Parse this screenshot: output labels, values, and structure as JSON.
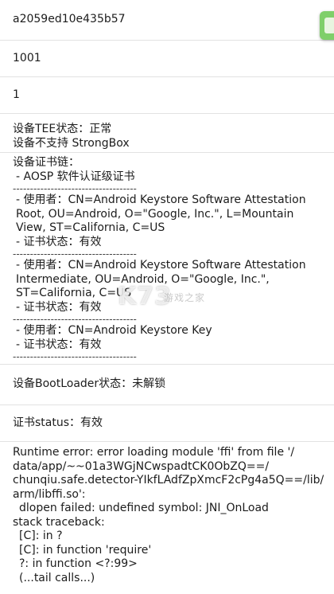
{
  "rows": {
    "device_id": "a2059ed10e435b57",
    "value_1001": "1001",
    "value_1": "1",
    "tee": {
      "status": "设备TEE状态：正常",
      "strongbox": "设备不支持 StrongBox"
    },
    "cert_chain": {
      "title": "设备证书链：",
      "aosp_line": "- AOSP 软件认证级证书",
      "dashes": "------------------------------------",
      "user1": "- 使用者：CN=Android Keystore Software Attestation Root, OU=Android, O=\"Google, Inc.\", L=Mountain View, ST=California, C=US",
      "status1": "- 证书状态：有效",
      "user2": "- 使用者：CN=Android Keystore Software Attestation Intermediate, OU=Android, O=\"Google, Inc.\", ST=California, C=US",
      "status2": "- 证书状态：有效",
      "user3": "- 使用者：CN=Android Keystore Key",
      "status3": "- 证书状态：有效"
    },
    "bootloader": "设备BootLoader状态：未解锁",
    "cert_status": "证书status：有效",
    "runtime_error": {
      "l1": "Runtime error: error loading module 'ffi' from file '/",
      "l2": "data/app/~~01a3WGjNCwspadtCK0ObZQ==/",
      "l3": "chunqiu.safe.detector-YIkfLAdfZpXmcF2cPg4a5Q==/lib/",
      "l4": "arm/libffi.so':",
      "l5": "dlopen failed: undefined symbol: JNI_OnLoad",
      "l6": "stack traceback:",
      "l7": "[C]: in ?",
      "l8": "[C]: in function 'require'",
      "l9": "?: in function <?:99>",
      "l10": "(...tail calls...)"
    }
  },
  "watermark": {
    "main": "K73",
    "sub": "游戏之家"
  },
  "colors": {
    "floating_button": "#7fcf6a",
    "divider": "#e2e2e2"
  }
}
